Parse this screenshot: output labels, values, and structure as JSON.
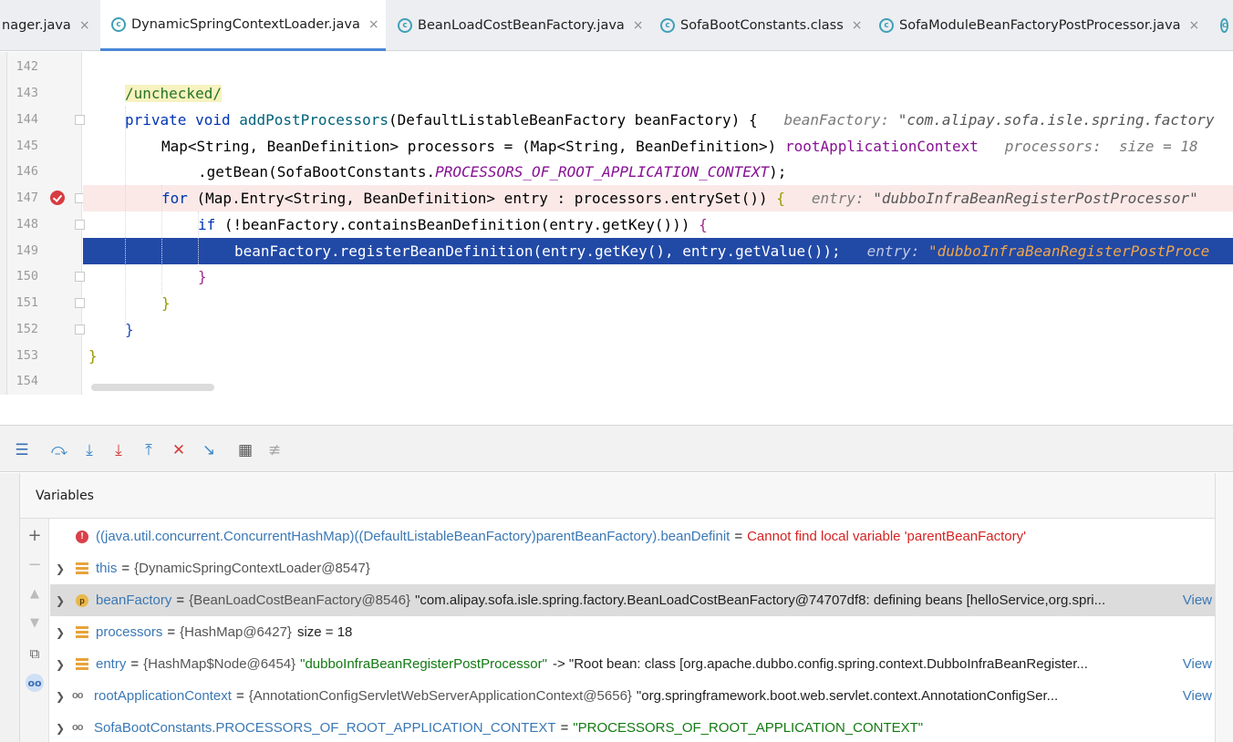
{
  "tabs": [
    {
      "label": "nager.java",
      "active": false
    },
    {
      "label": "DynamicSpringContextLoader.java",
      "active": true
    },
    {
      "label": "BeanLoadCostBeanFactory.java",
      "active": false
    },
    {
      "label": "SofaBootConstants.class",
      "active": false
    },
    {
      "label": "SofaModuleBeanFactoryPostProcessor.java",
      "active": false
    }
  ],
  "tab_icon_letter": "c",
  "editor": {
    "line_numbers": [
      "142",
      "143",
      "144",
      "145",
      "146",
      "147",
      "148",
      "149",
      "150",
      "151",
      "152",
      "153",
      "154"
    ],
    "code": {
      "l143_annotation": "/unchecked/",
      "l144_kw": "private void ",
      "l144_method": "addPostProcessors",
      "l144_open": "(",
      "l144_params": "DefaultListableBeanFactory beanFactory",
      "l144_close": ") {",
      "l144_hint_name": "beanFactory: ",
      "l144_hint_val": "\"com.alipay.sofa.isle.spring.factory",
      "l145_type": "Map<String, BeanDefinition> processors = (Map<String, BeanDefinition>) ",
      "l145_field": "rootApplicationContext",
      "l145_hint": "processors:  size = 18",
      "l146_call": ".getBean(SofaBootConstants.",
      "l146_const": "PROCESSORS_OF_ROOT_APPLICATION_CONTEXT",
      "l146_end": ");",
      "l147_kw": "for ",
      "l147_body": "(Map.Entry<String, BeanDefinition> entry : processors.entrySet()) ",
      "l147_brace": "{",
      "l147_hint_name": "entry: ",
      "l147_hint_val": "\"dubboInfraBeanRegisterPostProcessor\"",
      "l148_kw": "if ",
      "l148_body": "(!beanFactory.containsBeanDefinition(entry.getKey())) ",
      "l148_brace": "{",
      "l149_body": "beanFactory.registerBeanDefinition(entry.getKey(), entry.getValue());",
      "l149_hint_name": "entry: ",
      "l149_hint_val": "\"dubboInfraBeanRegisterPostProce",
      "l150": "}",
      "l151": "}",
      "l152": "}",
      "l153": "}"
    }
  },
  "debug_toolbar": {
    "buttons": [
      "show-execution-point",
      "step-over",
      "step-into",
      "force-step-into",
      "step-out",
      "drop-frame",
      "run-to-cursor",
      "evaluate-expression",
      "trace-current-stream"
    ]
  },
  "variables": {
    "panel_title": "Variables",
    "view_label": "View",
    "rows": [
      {
        "kind": "error",
        "name": "((java.util.concurrent.ConcurrentHashMap)((DefaultListableBeanFactory)parentBeanFactory).beanDefinit",
        "eq": "=",
        "value": "Cannot find local variable 'parentBeanFactory'"
      },
      {
        "kind": "field",
        "name": "this",
        "eq": "=",
        "type": "{DynamicSpringContextLoader@8547}"
      },
      {
        "kind": "param",
        "name": "beanFactory",
        "eq": "=",
        "type": "{BeanLoadCostBeanFactory@8546}",
        "value": "\"com.alipay.sofa.isle.spring.factory.BeanLoadCostBeanFactory@74707df8: defining beans [helloService,org.spri...",
        "view": true
      },
      {
        "kind": "field",
        "name": "processors",
        "eq": "=",
        "type": "{HashMap@6427}",
        "value": "size = 18"
      },
      {
        "kind": "field",
        "name": "entry",
        "eq": "=",
        "type": "{HashMap$Node@6454}",
        "string": "\"dubboInfraBeanRegisterPostProcessor\"",
        "value": "-> \"Root bean: class [org.apache.dubbo.config.spring.context.DubboInfraBeanRegister...",
        "view": true
      },
      {
        "kind": "watch",
        "name": "rootApplicationContext",
        "eq": "=",
        "type": "{AnnotationConfigServletWebServerApplicationContext@5656}",
        "value": "\"org.springframework.boot.web.servlet.context.AnnotationConfigSer...",
        "view": true
      },
      {
        "kind": "watch",
        "name": "SofaBootConstants.PROCESSORS_OF_ROOT_APPLICATION_CONTEXT",
        "eq": "=",
        "string": "\"PROCESSORS_OF_ROOT_APPLICATION_CONTEXT\""
      }
    ]
  },
  "colors": {
    "accent": "#4a87d6",
    "exec_line": "#2149a6",
    "breakpoint": "#d63c42"
  }
}
